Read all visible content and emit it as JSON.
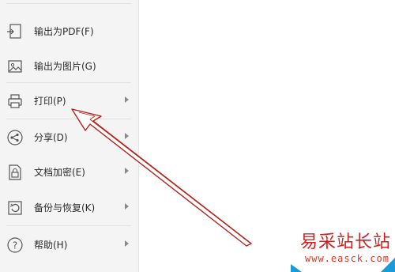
{
  "menu": {
    "items": [
      {
        "label": "输出为PDF(F)",
        "icon": "export-pdf-icon",
        "has_submenu": false
      },
      {
        "label": "输出为图片(G)",
        "icon": "export-image-icon",
        "has_submenu": false
      },
      {
        "label": "打印(P)",
        "icon": "printer-icon",
        "has_submenu": true
      },
      {
        "label": "分享(D)",
        "icon": "share-icon",
        "has_submenu": true
      },
      {
        "label": "文档加密(E)",
        "icon": "document-encrypt-icon",
        "has_submenu": true
      },
      {
        "label": "备份与恢复(K)",
        "icon": "backup-restore-icon",
        "has_submenu": true
      },
      {
        "label": "帮助(H)",
        "icon": "help-icon",
        "has_submenu": true
      }
    ]
  },
  "annotation": {
    "color": "#b3231d",
    "points_to": "打印(P)"
  },
  "watermark": {
    "title": "易采站长站",
    "url": "www.easck.com",
    "title_color": "#d11f1f",
    "corner_color": "#1a9bd7"
  }
}
